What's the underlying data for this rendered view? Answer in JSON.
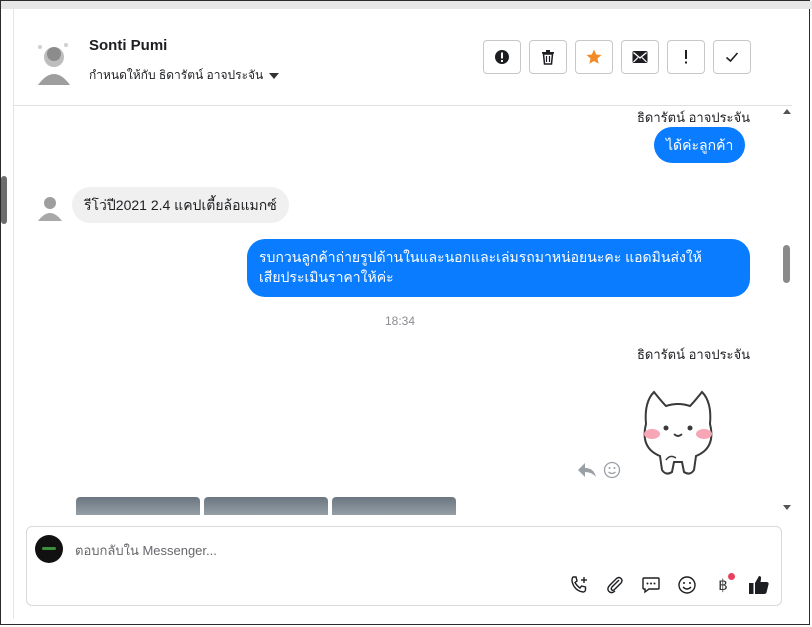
{
  "header": {
    "contact_name": "Sonti Pumi",
    "assigned_to": "กำหนดให้กับ ธิดารัตน์ อาจประจัน",
    "actions": [
      {
        "name": "spam-button",
        "icon": "alert-circle-icon"
      },
      {
        "name": "delete-button",
        "icon": "trash-icon"
      },
      {
        "name": "star-button",
        "icon": "star-icon"
      },
      {
        "name": "mark-unread-button",
        "icon": "envelope-icon"
      },
      {
        "name": "follow-up-button",
        "icon": "exclamation-icon"
      },
      {
        "name": "done-button",
        "icon": "check-icon"
      }
    ]
  },
  "messages": [
    {
      "sender": "ธิดารัตน์ อาจประจัน",
      "text": "ได้ค่ะลูกค้า",
      "direction": "out"
    },
    {
      "sender": "Sonti Pumi",
      "text": "รีโว่ปี2021 2.4 แคปเตี้ยล้อแมกซ์",
      "direction": "in"
    },
    {
      "text_line1": "รบกวนลูกค้าถ่ายรูปด้านในและนอกและเล่มรถมาหน่อยนะคะ แอดมินส่งให้",
      "text_line2": "เสียประเมินราคาให้ค่ะ",
      "direction": "out"
    },
    {
      "time": "18:34"
    },
    {
      "sender": "ธิดารัตน์ อาจประจัน",
      "sticker": "cat-sticker",
      "direction": "out"
    }
  ],
  "composer": {
    "placeholder": "ตอบกลับใน Messenger...",
    "tools": [
      "phone-add-icon",
      "paperclip-icon",
      "speech-bubble-icon",
      "emoji-icon",
      "baht-icon",
      "thumbs-up-icon"
    ],
    "baht_symbol": "฿"
  },
  "colors": {
    "bubble_out": "#0a7cff",
    "bubble_in": "#f0f0f0",
    "star": "#f28b26",
    "notification_dot": "#e8405f"
  }
}
